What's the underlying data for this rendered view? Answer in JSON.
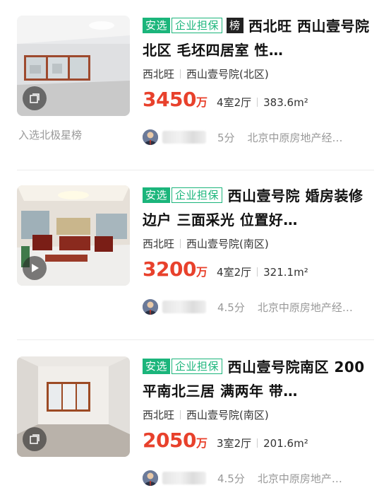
{
  "listings": [
    {
      "tag_select": "安选",
      "tag_guarantee": "企业担保",
      "tag_rank": "榜",
      "title": "西北旺 西山壹号院北区 毛坯四居室 性…",
      "district": "西北旺",
      "community": "西山壹号院(北区)",
      "price": "3450",
      "price_unit": "万",
      "layout": "4室2厅",
      "area": "383.6m²",
      "rank_note": "入选北极星榜",
      "score": "5分",
      "agency": "北京中原房地产经…",
      "thumb_icon": "gallery-icon"
    },
    {
      "tag_select": "安选",
      "tag_guarantee": "企业担保",
      "title": "西山壹号院 婚房装修 边户 三面采光 位置好…",
      "district": "西北旺",
      "community": "西山壹号院(南区)",
      "price": "3200",
      "price_unit": "万",
      "layout": "4室2厅",
      "area": "321.1m²",
      "score": "4.5分",
      "agency": "北京中原房地产经…",
      "thumb_icon": "play-icon"
    },
    {
      "tag_select": "安选",
      "tag_guarantee": "企业担保",
      "title": "西山壹号院南区 200平南北三居 满两年 带…",
      "district": "西北旺",
      "community": "西山壹号院(南区)",
      "price": "2050",
      "price_unit": "万",
      "layout": "3室2厅",
      "area": "201.6m²",
      "score": "4.5分",
      "agency": "北京中原房地产…",
      "thumb_icon": "gallery-icon"
    }
  ],
  "colors": {
    "accent_green": "#1bb57b",
    "price_red": "#e8412c",
    "muted": "#999999"
  }
}
